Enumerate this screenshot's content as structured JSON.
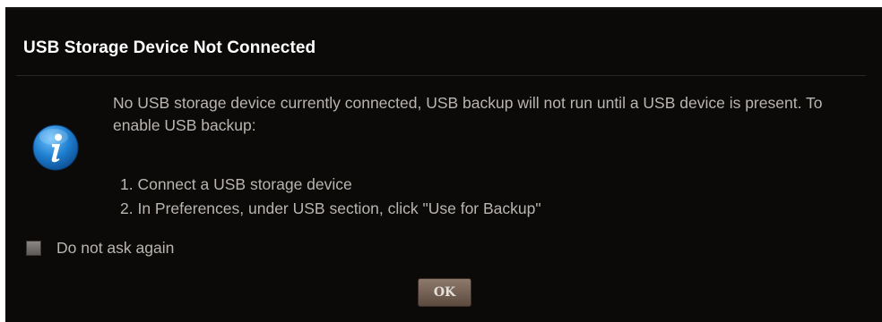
{
  "dialog": {
    "title": "USB Storage Device Not Connected",
    "message": "No USB storage device currently connected, USB backup will not run until a USB device is present. To enable USB backup:",
    "steps": [
      "1. Connect a USB storage device",
      "2. In Preferences, under USB section, click \"Use for Backup\""
    ],
    "icon": "info-icon",
    "checkbox": {
      "label": "Do not ask again",
      "checked": false
    },
    "ok_label": "OK"
  },
  "colors": {
    "background": "#0b0a09",
    "title_text": "#ffffff",
    "body_text": "#b9b5b0",
    "icon_blue": "#1f7fd0",
    "button": "#7a6558"
  }
}
